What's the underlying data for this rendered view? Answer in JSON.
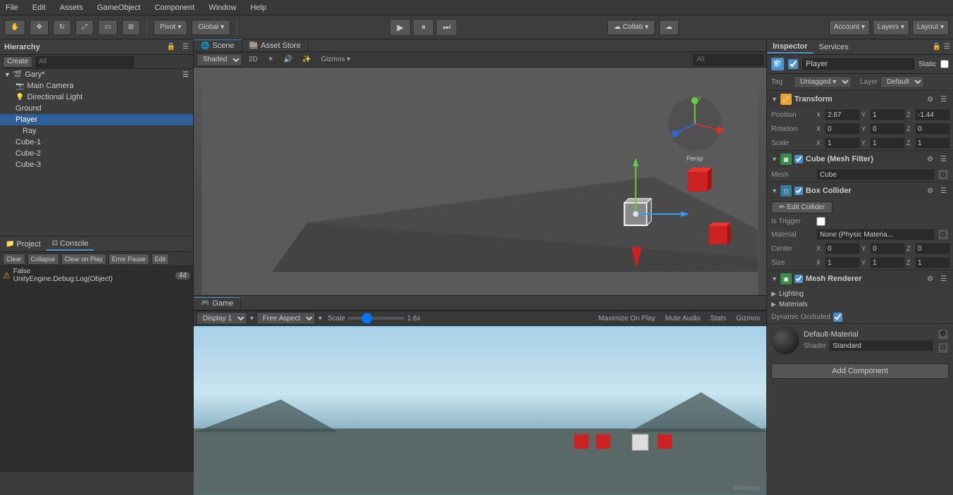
{
  "menuBar": {
    "items": [
      "File",
      "Edit",
      "Assets",
      "GameObject",
      "Component",
      "Window",
      "Help"
    ]
  },
  "toolbar": {
    "pivotLabel": "Pivot",
    "globalLabel": "Global",
    "accountLabel": "Account",
    "layersLabel": "Layers",
    "layoutLabel": "Layout",
    "collab": "Collab"
  },
  "hierarchy": {
    "title": "Hierarchy",
    "createLabel": "Create",
    "searchPlaceholder": "All",
    "items": [
      {
        "name": "Gary*",
        "level": 0,
        "hasArrow": true,
        "isParent": true
      },
      {
        "name": "Main Camera",
        "level": 1
      },
      {
        "name": "Directional Light",
        "level": 1
      },
      {
        "name": "Ground",
        "level": 1
      },
      {
        "name": "Player",
        "level": 1,
        "selected": true
      },
      {
        "name": "Ray",
        "level": 2
      },
      {
        "name": "Cube-1",
        "level": 1
      },
      {
        "name": "Cube-2",
        "level": 1
      },
      {
        "name": "Cube-3",
        "level": 1
      }
    ]
  },
  "console": {
    "tabProject": "Project",
    "tabConsole": "Console",
    "clearBtn": "Clear",
    "collapseBtn": "Collapse",
    "clearOnPlayBtn": "Clear on Play",
    "errorPauseBtn": "Error Pause",
    "editBtn": "Edit",
    "logText": "False\nUnityEngine.Debug:Log(Object)",
    "logCount": "44"
  },
  "sceneView": {
    "title": "Scene",
    "shaderMode": "Shaded",
    "is2D": "2D",
    "gizmosLabel": "Gizmos",
    "searchPlaceholder": "All"
  },
  "assetStore": {
    "title": "Asset Store"
  },
  "gameView": {
    "title": "Game",
    "display": "Display 1",
    "aspect": "Free Aspect",
    "scaleLabel": "Scale",
    "scaleValue": "1.6x",
    "maximizeOnPlay": "Maximize On Play",
    "muteAudio": "Mute Audio",
    "stats": "Stats",
    "gizmos": "Gizmos"
  },
  "inspector": {
    "title": "Inspector",
    "servicesTitle": "Services",
    "objectName": "Player",
    "staticLabel": "Static",
    "tagLabel": "Tag",
    "tagValue": "Untagged",
    "layerLabel": "Layer",
    "layerValue": "Default",
    "transform": {
      "title": "Transform",
      "positionLabel": "Position",
      "posX": "2.67",
      "posY": "1",
      "posZ": "-1.44",
      "rotationLabel": "Rotation",
      "rotX": "0",
      "rotY": "0",
      "rotZ": "0",
      "scaleLabel": "Scale",
      "scaleX": "1",
      "scaleY": "1",
      "scaleZ": "1"
    },
    "meshFilter": {
      "title": "Cube (Mesh Filter)",
      "meshLabel": "Mesh",
      "meshValue": "Cube"
    },
    "boxCollider": {
      "title": "Box Collider",
      "editColliderBtn": "Edit Collider",
      "isTriggerLabel": "Is Trigger",
      "materialLabel": "Material",
      "materialValue": "None (Physic Materia...",
      "centerLabel": "Center",
      "cx": "0",
      "cy": "0",
      "cz": "0",
      "sizeLabel": "Size",
      "sx": "1",
      "sy": "1",
      "sz": "1"
    },
    "meshRenderer": {
      "title": "Mesh Renderer",
      "lightingLabel": "Lighting",
      "materialsLabel": "Materials",
      "dynamicOccludedLabel": "Dynamic Occluded"
    },
    "material": {
      "name": "Default-Material",
      "shaderLabel": "Shader",
      "shaderValue": "Standard"
    },
    "addComponentBtn": "Add Component"
  }
}
